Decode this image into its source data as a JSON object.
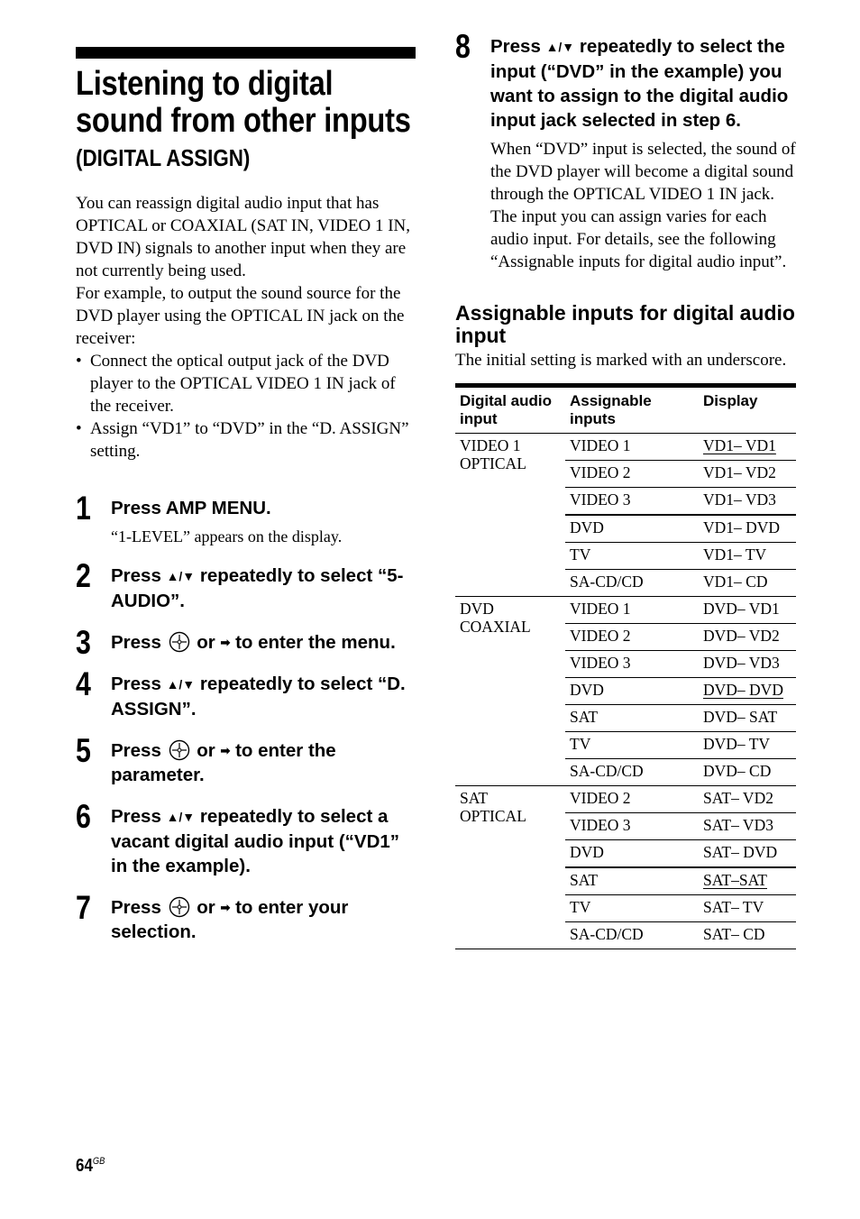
{
  "heading": {
    "title": "Listening to digital sound from other inputs",
    "subtitle": "(DIGITAL ASSIGN)"
  },
  "intro": {
    "paragraph1": "You can reassign digital audio input that has OPTICAL or COAXIAL (SAT IN, VIDEO 1 IN, DVD IN) signals to another input when they are not currently being used.",
    "paragraph2": "For example, to output the sound source for the DVD player using the OPTICAL IN jack on the receiver:",
    "bullet_symbol": "•",
    "bullets": [
      "Connect the optical output jack of the DVD player to the OPTICAL VIDEO 1 IN jack of the receiver.",
      "Assign “VD1” to “DVD” in the “D. ASSIGN” setting."
    ]
  },
  "icons": {
    "up_down": "▲/▼",
    "right": "➡"
  },
  "steps": [
    {
      "number": "1",
      "text": "Press AMP MENU.",
      "desc": "“1-LEVEL” appears on the display."
    },
    {
      "number": "2",
      "pre": "Press",
      "post": "repeatedly to select “5-AUDIO”."
    },
    {
      "number": "3",
      "pre": "Press",
      "mid": "or",
      "post": "to enter the menu."
    },
    {
      "number": "4",
      "pre": "Press",
      "post": "repeatedly to select “D. ASSIGN”."
    },
    {
      "number": "5",
      "pre": "Press",
      "mid": "or",
      "post": "to enter the parameter."
    },
    {
      "number": "6",
      "pre": "Press",
      "post": "repeatedly to select a vacant digital audio input (“VD1” in the example)."
    },
    {
      "number": "7",
      "pre": "Press",
      "mid": "or",
      "post": "to enter your selection."
    },
    {
      "number": "8",
      "pre": "Press",
      "post": "repeatedly to select the input (“DVD” in the example) you want to assign to the digital audio input jack selected in step 6.",
      "desc1": "When “DVD” input is selected, the sound of the DVD player will become a digital sound through the OPTICAL VIDEO 1 IN jack.",
      "desc2": "The input you can assign varies for each audio input. For details, see the following “Assignable inputs for digital audio input”."
    }
  ],
  "assignable": {
    "title": "Assignable inputs for digital audio input",
    "note": "The initial setting is marked with an underscore.",
    "columns": [
      "Digital audio input",
      "Assignable inputs",
      "Display"
    ],
    "groups": [
      {
        "input_line1": "VIDEO 1",
        "input_line2": "OPTICAL",
        "rows": [
          {
            "input": "VIDEO 1",
            "display": "VD1– VD1",
            "initial": true
          },
          {
            "input": "VIDEO 2",
            "display": "VD1– VD2"
          },
          {
            "input": "VIDEO 3",
            "display": "VD1– VD3"
          },
          {
            "input": "DVD",
            "display": "VD1– DVD"
          },
          {
            "input": "TV",
            "display": "VD1– TV"
          },
          {
            "input": "SA-CD/CD",
            "display": "VD1– CD"
          }
        ]
      },
      {
        "input_line1": "DVD",
        "input_line2": "COAXIAL",
        "rows": [
          {
            "input": "VIDEO 1",
            "display": "DVD– VD1"
          },
          {
            "input": "VIDEO 2",
            "display": "DVD– VD2"
          },
          {
            "input": "VIDEO 3",
            "display": "DVD– VD3"
          },
          {
            "input": "DVD",
            "display": "DVD– DVD",
            "initial": true
          },
          {
            "input": "SAT",
            "display": "DVD– SAT"
          },
          {
            "input": "TV",
            "display": "DVD– TV"
          },
          {
            "input": "SA-CD/CD",
            "display": "DVD– CD"
          }
        ]
      },
      {
        "input_line1": "SAT",
        "input_line2": "OPTICAL",
        "rows": [
          {
            "input": "VIDEO 2",
            "display": "SAT– VD2"
          },
          {
            "input": "VIDEO 3",
            "display": "SAT– VD3"
          },
          {
            "input": "DVD",
            "display": "SAT– DVD"
          },
          {
            "input": "SAT",
            "display": "SAT–SAT",
            "initial": true
          },
          {
            "input": "TV",
            "display": "SAT– TV"
          },
          {
            "input": "SA-CD/CD",
            "display": "SAT– CD"
          }
        ]
      }
    ]
  },
  "footer": {
    "page_number": "64",
    "region": "GB"
  }
}
